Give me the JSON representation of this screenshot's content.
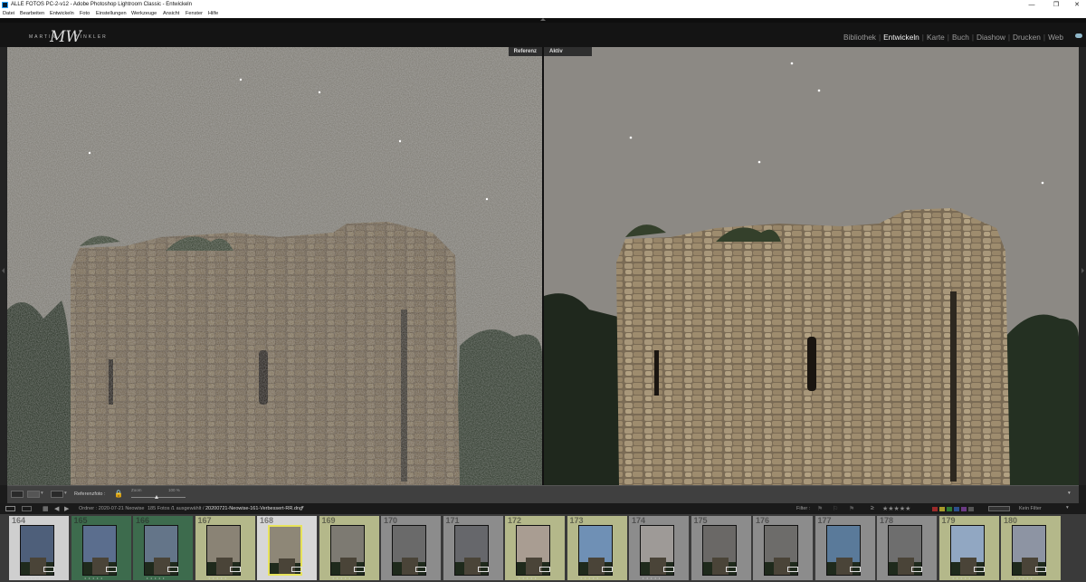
{
  "window": {
    "title": "ALLE FOTOS PC-2-v12 - Adobe Photoshop Lightroom Classic - Entwickeln",
    "controls": [
      "—",
      "❐",
      "✕"
    ]
  },
  "menu": [
    "Datei",
    "Bearbeiten",
    "Entwickeln",
    "Foto",
    "Einstellungen",
    "Werkzeuge",
    "Ansicht",
    "Fenster",
    "Hilfe"
  ],
  "identity_plate": {
    "left": "MARTIN",
    "right": "WINKLER"
  },
  "modules": [
    {
      "label": "Bibliothek",
      "active": false
    },
    {
      "label": "Entwickeln",
      "active": true
    },
    {
      "label": "Karte",
      "active": false
    },
    {
      "label": "Buch",
      "active": false
    },
    {
      "label": "Diashow",
      "active": false
    },
    {
      "label": "Drucken",
      "active": false
    },
    {
      "label": "Web",
      "active": false
    }
  ],
  "compare": {
    "reference_label": "Referenz",
    "active_label": "Aktiv"
  },
  "toolbar": {
    "reference_photo_label": "Referenzfoto :",
    "zoom_label": "Zoom",
    "zoom_value": "100 %"
  },
  "filmstrip_bar": {
    "source": "Ordner : 2020-07-21 Neowise",
    "count": "185 Fotos /",
    "selected": "1 ausgewählt /",
    "filename": "20200721-Neowise-161-Verbessert-RR.dng",
    "filter_label": "Filter :",
    "filter_value": "Kein Filter",
    "stars": "★★★★★",
    "color_labels": [
      "#9b2a2a",
      "#a89a2a",
      "#2f7a34",
      "#2c4f8c",
      "#6b3a84",
      "#555555"
    ]
  },
  "thumbnails": [
    {
      "num": "164",
      "bg": "#cfcfcf",
      "sky": "#4e5f7a",
      "dots": "• • • • •"
    },
    {
      "num": "165",
      "bg": "#3d6b4d",
      "sky": "#5b6e8e",
      "dots": "• • • • •"
    },
    {
      "num": "166",
      "bg": "#3d6b4d",
      "sky": "#647589",
      "dots": "• • • • •"
    },
    {
      "num": "167",
      "bg": "#b4b88a",
      "sky": "#8a8375",
      "dots": "• • • • •"
    },
    {
      "num": "168",
      "bg": "#d7d7d7",
      "sky": "#8e8777",
      "dots": "• • • • •",
      "selected": true
    },
    {
      "num": "169",
      "bg": "#b4b88a",
      "sky": "#7d7a72",
      "dots": "• • • • •"
    },
    {
      "num": "170",
      "bg": "#8c8c8c",
      "sky": "#6a6a6a",
      "dots": ""
    },
    {
      "num": "171",
      "bg": "#8c8c8c",
      "sky": "#66676b",
      "dots": ""
    },
    {
      "num": "172",
      "bg": "#b4b88a",
      "sky": "#a99d92",
      "dots": "• • • • •"
    },
    {
      "num": "173",
      "bg": "#b4b88a",
      "sky": "#6f90b5",
      "dots": "• • • • •"
    },
    {
      "num": "174",
      "bg": "#8c8c8c",
      "sky": "#9e9a97",
      "dots": "• • • • •"
    },
    {
      "num": "175",
      "bg": "#8c8c8c",
      "sky": "#6a6866",
      "dots": ""
    },
    {
      "num": "176",
      "bg": "#8c8c8c",
      "sky": "#6d6c6a",
      "dots": ""
    },
    {
      "num": "177",
      "bg": "#8c8c8c",
      "sky": "#5a7a9a",
      "dots": ""
    },
    {
      "num": "178",
      "bg": "#8c8c8c",
      "sky": "#6e6e6e",
      "dots": ""
    },
    {
      "num": "179",
      "bg": "#b4b88a",
      "sky": "#91a7c2",
      "dots": "• • • • •"
    },
    {
      "num": "180",
      "bg": "#b4b88a",
      "sky": "#8d94a3",
      "dots": "• • • • •"
    }
  ]
}
